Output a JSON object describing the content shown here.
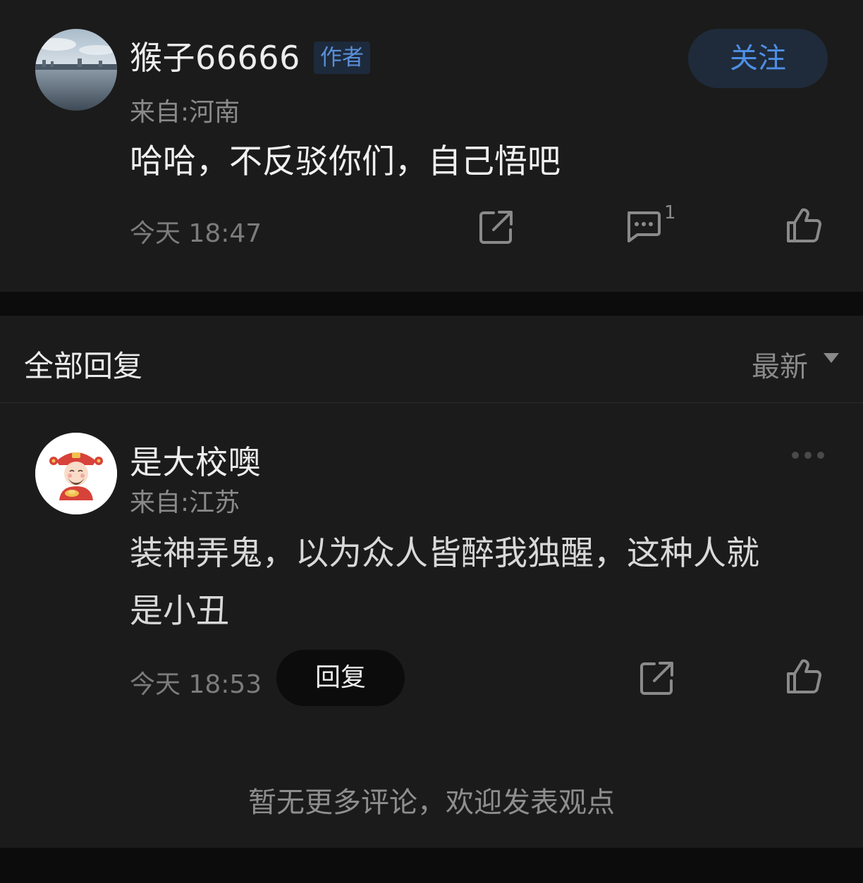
{
  "post": {
    "username": "猴子66666",
    "author_badge": "作者",
    "follow_label": "关注",
    "origin": "来自:河南",
    "content": "哈哈，不反驳你们，自己悟吧",
    "timestamp": "今天 18:47",
    "comment_count": "1",
    "icons": [
      "share-icon",
      "comment-icon",
      "like-icon"
    ]
  },
  "replies_section": {
    "title": "全部回复",
    "sort_label": "最新",
    "sort_icon": "dropdown-triangle-icon"
  },
  "reply": {
    "username": "是大校噢",
    "origin": "来自:江苏",
    "content_line1": "装神弄鬼，以为众人皆醉我独醒，这种人就",
    "content_line2": "是小丑",
    "timestamp": "今天 18:53",
    "reply_label": "回复",
    "icons": [
      "more-icon",
      "share-icon",
      "like-icon"
    ]
  },
  "footer": {
    "no_more_text": "暂无更多评论，欢迎发表观点"
  },
  "colors": {
    "background": "#0c0c0c",
    "card": "#1b1b1b",
    "accent_blue": "#4e8fe6",
    "follow_bg": "#1f2b3a"
  }
}
